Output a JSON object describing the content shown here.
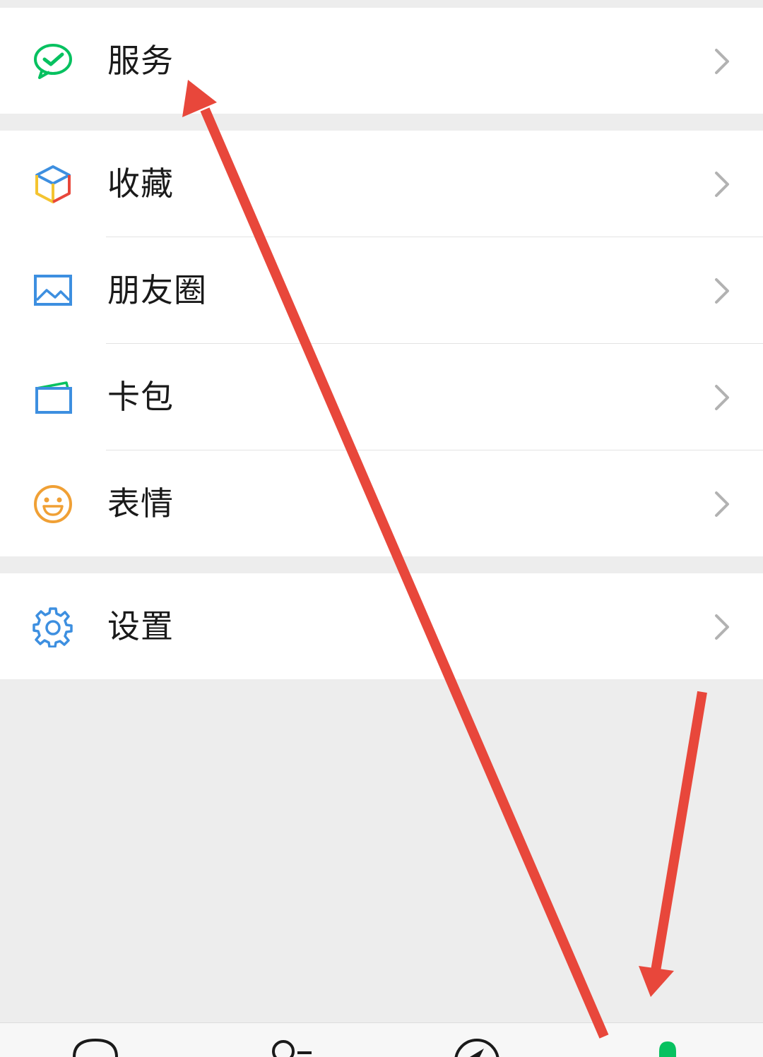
{
  "menu": {
    "services_label": "服务",
    "favorites_label": "收藏",
    "moments_label": "朋友圈",
    "cards_label": "卡包",
    "stickers_label": "表情",
    "settings_label": "设置"
  },
  "icons": {
    "services": "wechat-pay-chat-icon",
    "favorites": "cube-icon",
    "moments": "picture-icon",
    "cards": "card-wallet-icon",
    "stickers": "smiley-icon",
    "settings": "gear-icon",
    "chevron": "chevron-right-icon"
  },
  "tabbar": {
    "tabs": [
      "chats-icon",
      "contacts-icon",
      "discover-icon",
      "me-icon"
    ],
    "active_tab": "me-icon"
  },
  "colors": {
    "annotation_arrow": "#e8473b",
    "accent_green": "#07c160",
    "background": "#ededed"
  }
}
